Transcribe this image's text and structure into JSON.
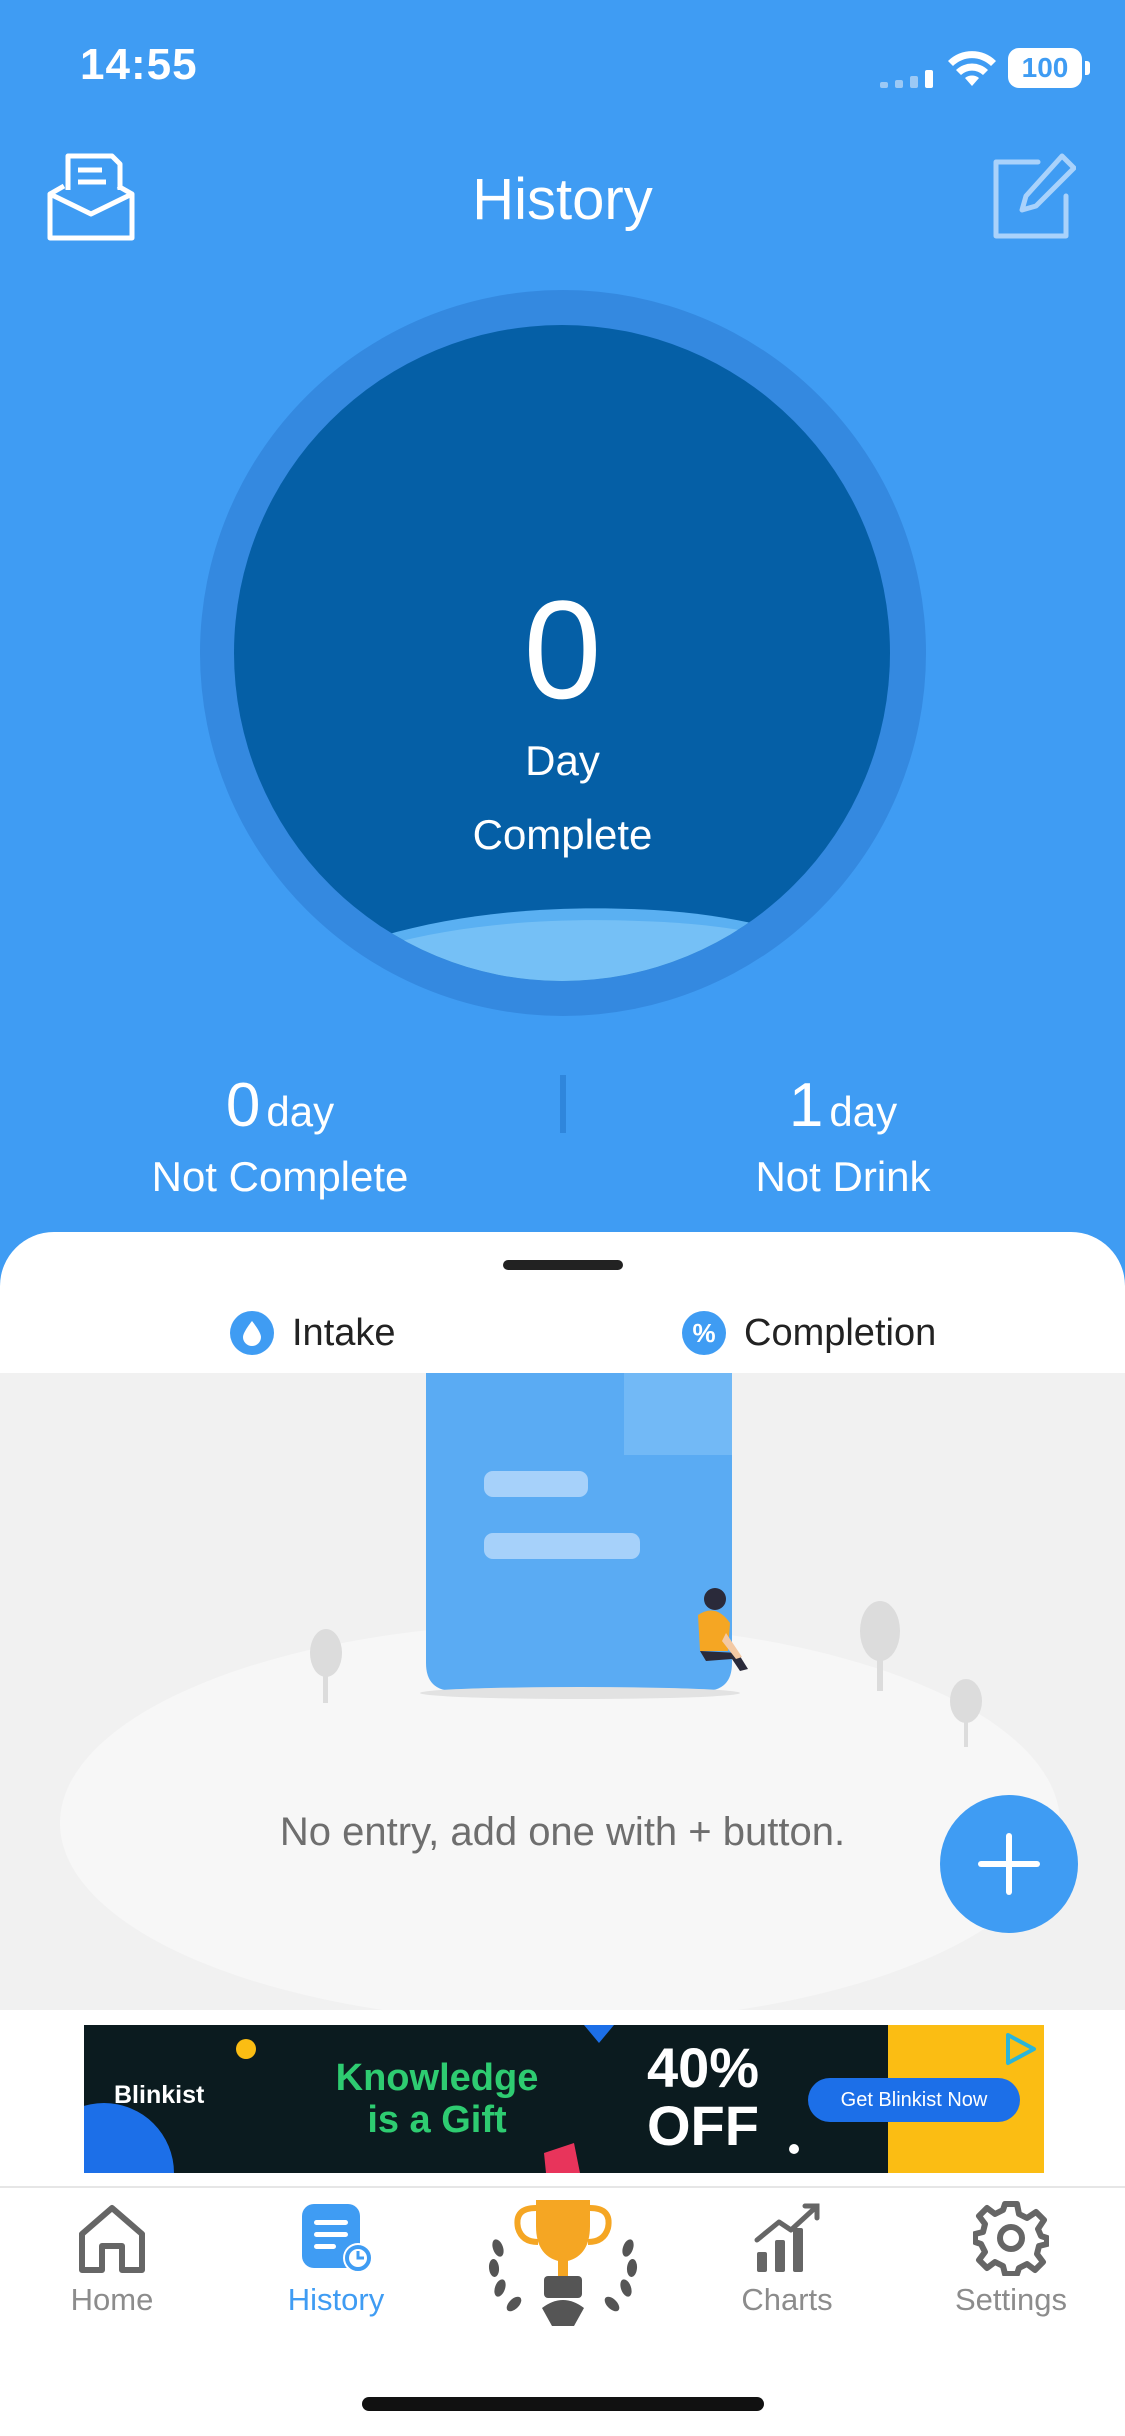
{
  "status_bar": {
    "time": "14:55",
    "battery": "100"
  },
  "header": {
    "title": "History",
    "left_icon": "mail-inbox-icon",
    "right_icon": "edit-icon"
  },
  "summary": {
    "value": "0",
    "unit": "Day",
    "label": "Complete"
  },
  "stats": {
    "not_complete": {
      "value": "0",
      "unit": "day",
      "label": "Not Complete"
    },
    "not_drink": {
      "value": "1",
      "unit": "day",
      "label": "Not Drink"
    }
  },
  "segments": [
    {
      "label": "Intake",
      "icon": "water-drop-icon"
    },
    {
      "label": "Completion",
      "icon": "percent-icon",
      "glyph": "%"
    }
  ],
  "empty_state": {
    "message": "No entry, add one with + button."
  },
  "fab": {
    "icon": "plus-icon"
  },
  "ad": {
    "brand": "Blinkist",
    "headline_line1": "Knowledge",
    "headline_line2": "is a Gift",
    "offer_line1": "40%",
    "offer_line2": "OFF",
    "cta": "Get Blinkist Now"
  },
  "tabs": [
    {
      "label": "Home",
      "icon": "home-icon"
    },
    {
      "label": "History",
      "icon": "history-icon",
      "active": true
    },
    {
      "label": "",
      "icon": "trophy-icon"
    },
    {
      "label": "Charts",
      "icon": "charts-icon"
    },
    {
      "label": "Settings",
      "icon": "gear-icon"
    }
  ],
  "colors": {
    "primary": "#3f9cf3",
    "disc": "#055fa6",
    "ring": "#3489e0"
  }
}
